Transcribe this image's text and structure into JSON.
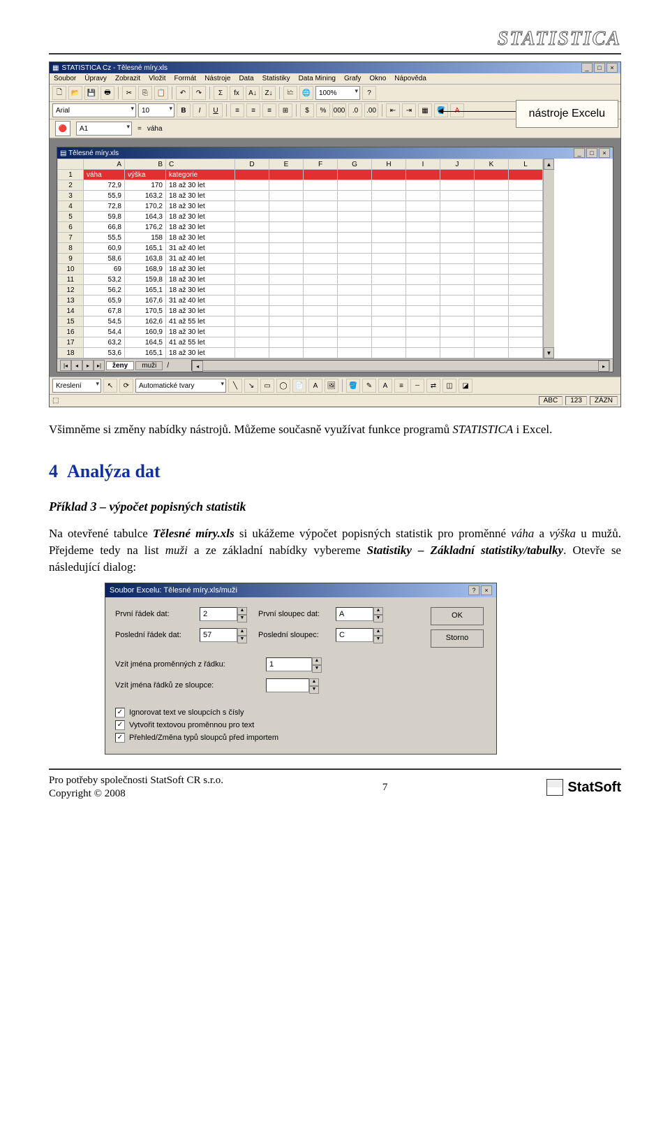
{
  "brand": "STATISTICA",
  "callout_label": "nástroje Excelu",
  "app": {
    "title": "STATISTICA Cz - Tělesné míry.xls",
    "menus": [
      "Soubor",
      "Úpravy",
      "Zobrazit",
      "Vložit",
      "Formát",
      "Nástroje",
      "Data",
      "Statistiky",
      "Data Mining",
      "Grafy",
      "Okno",
      "Nápověda"
    ],
    "font_name": "Arial",
    "font_size": "10",
    "zoom": "100%",
    "cell_ref": "A1",
    "cell_eq": "=",
    "cell_val": "váha",
    "inner_title": "Tělesné míry.xls",
    "columns": [
      "A",
      "B",
      "C",
      "D",
      "E",
      "F",
      "G",
      "H",
      "I",
      "J",
      "K",
      "L"
    ],
    "header_vals": [
      "váha",
      "výška",
      "kategorie"
    ],
    "data_rows": [
      [
        "2",
        "72,9",
        "170",
        "18 až 30 let"
      ],
      [
        "3",
        "55,9",
        "163,2",
        "18 až 30 let"
      ],
      [
        "4",
        "72,8",
        "170,2",
        "18 až 30 let"
      ],
      [
        "5",
        "59,8",
        "164,3",
        "18 až 30 let"
      ],
      [
        "6",
        "66,8",
        "176,2",
        "18 až 30 let"
      ],
      [
        "7",
        "55,5",
        "158",
        "18 až 30 let"
      ],
      [
        "8",
        "60,9",
        "165,1",
        "31 až 40 let"
      ],
      [
        "9",
        "58,6",
        "163,8",
        "31 až 40 let"
      ],
      [
        "10",
        "69",
        "168,9",
        "18 až 30 let"
      ],
      [
        "11",
        "53,2",
        "159,8",
        "18 až 30 let"
      ],
      [
        "12",
        "56,2",
        "165,1",
        "18 až 30 let"
      ],
      [
        "13",
        "65,9",
        "167,6",
        "31 až 40 let"
      ],
      [
        "14",
        "67,8",
        "170,5",
        "18 až 30 let"
      ],
      [
        "15",
        "54,5",
        "162,6",
        "41 až 55 let"
      ],
      [
        "16",
        "54,4",
        "160,9",
        "18 až 30 let"
      ],
      [
        "17",
        "63,2",
        "164,5",
        "41 až 55 let"
      ],
      [
        "18",
        "53,6",
        "165,1",
        "18 až 30 let"
      ]
    ],
    "tabs": [
      "ženy",
      "muži"
    ],
    "draw_label": "Kreslení",
    "autoshapes_label": "Automatické tvary",
    "status_boxes": [
      "ABC",
      "123",
      "ZÁZN"
    ]
  },
  "body": {
    "p1_a": "Všimněme si změny nabídky nástrojů. Můžeme současně využívat funkce programů ",
    "p1_b": "STATISTICA",
    "p1_c": " i Excel.",
    "section_no": "4",
    "section_title": "Analýza dat",
    "example_title": "Příklad 3 – výpočet popisných statistik",
    "p2_a": "Na otevřené tabulce ",
    "p2_b": "Tělesné míry.xls",
    "p2_c": " si ukážeme výpočet popisných statistik pro proměnné ",
    "p2_d": "váha",
    "p2_e": " a ",
    "p2_f": "výška",
    "p2_g": " u mužů. Přejdeme tedy na list ",
    "p2_h": "muži",
    "p2_i": " a ze základní nabídky vybereme ",
    "p2_j": "Statistiky – Základní statistiky/tabulky",
    "p2_k": ". Otevře se následující dialog:"
  },
  "dialog": {
    "title": "Soubor Excelu: Tělesné míry.xls/muži",
    "first_row_label": "První řádek dat:",
    "first_row_val": "2",
    "first_col_label": "První sloupec dat:",
    "first_col_val": "A",
    "last_row_label": "Poslední řádek dat:",
    "last_row_val": "57",
    "last_col_label": "Poslední sloupec:",
    "last_col_val": "C",
    "varnames_label": "Vzít jména proměnných z řádku:",
    "varnames_val": "1",
    "rownames_label": "Vzít jména řádků ze sloupce:",
    "chk1": "Ignorovat text ve sloupcích s čísly",
    "chk2": "Vytvořit textovou proměnnou pro text",
    "chk3": "Přehled/Změna typů sloupců před importem",
    "ok": "OK",
    "cancel": "Storno"
  },
  "footer": {
    "line1": "Pro potřeby společnosti StatSoft CR s.r.o.",
    "line2": "Copyright © 2008",
    "page": "7",
    "logo": "StatSoft"
  }
}
